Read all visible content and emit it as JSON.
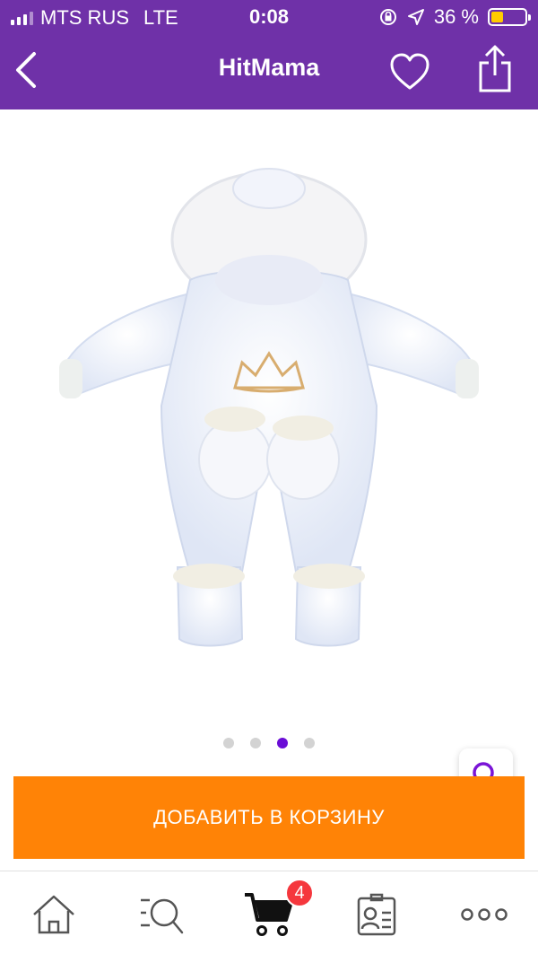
{
  "status_bar": {
    "carrier": "MTS RUS",
    "network": "LTE",
    "time": "0:08",
    "battery": "36 %",
    "battery_level": 0.36,
    "battery_color": "#ffcc00"
  },
  "nav": {
    "title": "HitMama",
    "back_icon": "chevron-left-icon",
    "favorite_icon": "heart-icon",
    "share_icon": "share-icon"
  },
  "gallery": {
    "image_count": 4,
    "active_index": 2,
    "zoom_icon": "search-icon"
  },
  "actions": {
    "add_to_cart_label": "ДОБАВИТЬ В КОРЗИНУ"
  },
  "tabbar": {
    "items": [
      {
        "icon": "home-icon"
      },
      {
        "icon": "search-list-icon"
      },
      {
        "icon": "cart-icon",
        "badge": "4"
      },
      {
        "icon": "profile-card-icon"
      },
      {
        "icon": "more-icon"
      }
    ]
  },
  "colors": {
    "header": "#6f31a8",
    "accent": "#ff8306",
    "active_dot": "#6a0dd6",
    "badge": "#f5373d"
  }
}
